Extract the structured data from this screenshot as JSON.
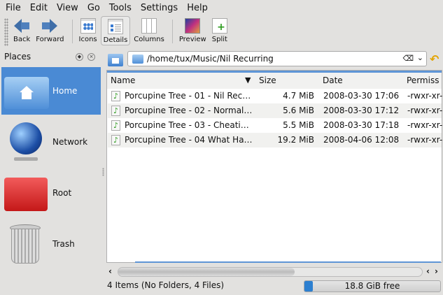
{
  "menu": [
    "File",
    "Edit",
    "View",
    "Go",
    "Tools",
    "Settings",
    "Help"
  ],
  "toolbar": {
    "back": "Back",
    "forward": "Forward",
    "icons": "Icons",
    "details": "Details",
    "columns": "Columns",
    "preview": "Preview",
    "split": "Split"
  },
  "places": {
    "title": "Places",
    "items": [
      {
        "label": "Home"
      },
      {
        "label": "Network"
      },
      {
        "label": "Root"
      },
      {
        "label": "Trash"
      }
    ]
  },
  "location": {
    "path": "/home/tux/Music/Nil Recurring"
  },
  "columns": {
    "name": "Name",
    "size": "Size",
    "date": "Date",
    "perm": "Permiss"
  },
  "files": [
    {
      "name": "Porcupine Tree - 01 - Nil Rec…",
      "size": "4.7 MiB",
      "date": "2008-03-30 17:06",
      "perm": "-rwxr-xr-:"
    },
    {
      "name": "Porcupine Tree - 02 - Normal…",
      "size": "5.6 MiB",
      "date": "2008-03-30 17:12",
      "perm": "-rwxr-xr-:"
    },
    {
      "name": "Porcupine Tree - 03 - Cheati…",
      "size": "5.5 MiB",
      "date": "2008-03-30 17:18",
      "perm": "-rwxr-xr-:"
    },
    {
      "name": "Porcupine Tree - 04 What Ha…",
      "size": "19.2 MiB",
      "date": "2008-04-06 12:08",
      "perm": "-rwxr-xr-:"
    }
  ],
  "status": {
    "text": "4 Items (No Folders, 4 Files)",
    "free": "18.8 GiB free",
    "used_fraction": 0.06
  },
  "scroll": {
    "horizontal_fraction": 0.58
  }
}
